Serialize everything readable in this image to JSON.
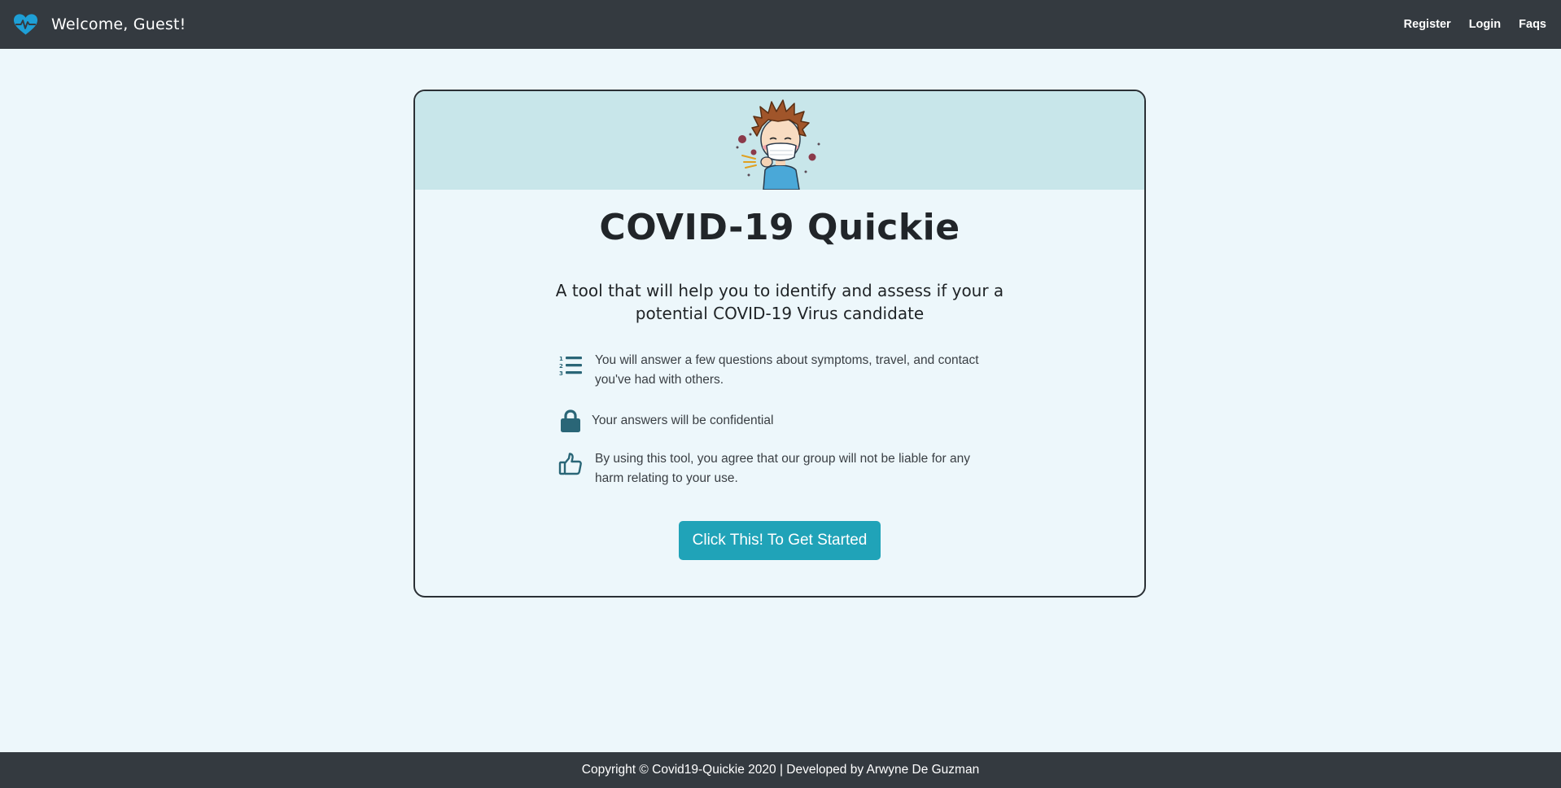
{
  "navbar": {
    "brand_icon": "heart-pulse-icon",
    "brand_color": "#1e9fd6",
    "welcome_text": "Welcome, Guest!",
    "links": [
      "Register",
      "Login",
      "Faqs"
    ]
  },
  "card": {
    "illustration": "sneezing-kid-with-mask-illustration",
    "title": "COVID-19 Quickie",
    "subtitle": "A tool that will help you to identify and assess if your a potential COVID-19 Virus candidate",
    "features": [
      {
        "icon": "numbered-list-icon",
        "text": "You will answer a few questions about symptoms, travel, and contact you've had with others."
      },
      {
        "icon": "lock-icon",
        "text": "Your answers will be confidential"
      },
      {
        "icon": "thumbs-up-icon",
        "text": "By using this tool, you agree that our group will not be liable for any harm relating to your use."
      }
    ],
    "button_label": "Click This! To Get Started",
    "accent_color": "#20a3b8",
    "icon_color": "#2a6677"
  },
  "footer": {
    "text": "Copyright © Covid19-Quickie 2020 | Developed by Arwyne De Guzman"
  }
}
